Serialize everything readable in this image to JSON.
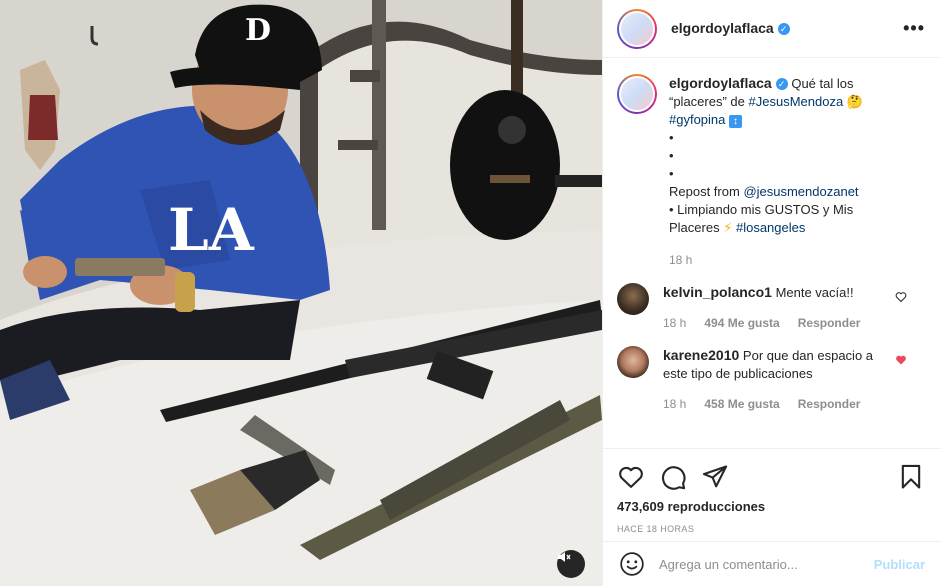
{
  "post": {
    "username": "elgordoylaflaca",
    "more_label": "•••",
    "caption": {
      "line1_text": "Qué tal los",
      "line2_text": "“placeres” de",
      "hashtag_jesus": "#JesusMendoza",
      "hashtag_gyf": "#gyfopina",
      "bullet": "•",
      "repost_text": "Repost from",
      "repost_handle": "@jesusmendozanet",
      "line_limpiando": "• Limpiando mis GUSTOS y Mis",
      "line_placeres": "Placeres",
      "hashtag_la": "#losangeles",
      "time": "18 h"
    },
    "comments": [
      {
        "username": "kelvin_polanco1",
        "text": "Mente vacía!!",
        "time": "18 h",
        "likes": "494 Me gusta",
        "reply": "Responder",
        "liked": false
      },
      {
        "username": "karene2010",
        "text": "Por que dan espacio a este tipo de publicaciones",
        "time": "18 h",
        "likes": "458 Me gusta",
        "reply": "Responder",
        "liked": true
      }
    ],
    "views": "473,609 reproducciones",
    "posted_ago": "HACE 18 HORAS",
    "add_comment": {
      "placeholder": "Agrega un comentario...",
      "publish_label": "Publicar"
    },
    "colors": {
      "accent": "#3897f0",
      "liked_heart": "#ed4956",
      "link": "#00376b",
      "publish_disabled": "#b2dffc"
    }
  },
  "media": {
    "cap_letter": "D",
    "shirt_letters": "LA",
    "icons": {
      "mute": "speaker-muted-icon"
    }
  }
}
